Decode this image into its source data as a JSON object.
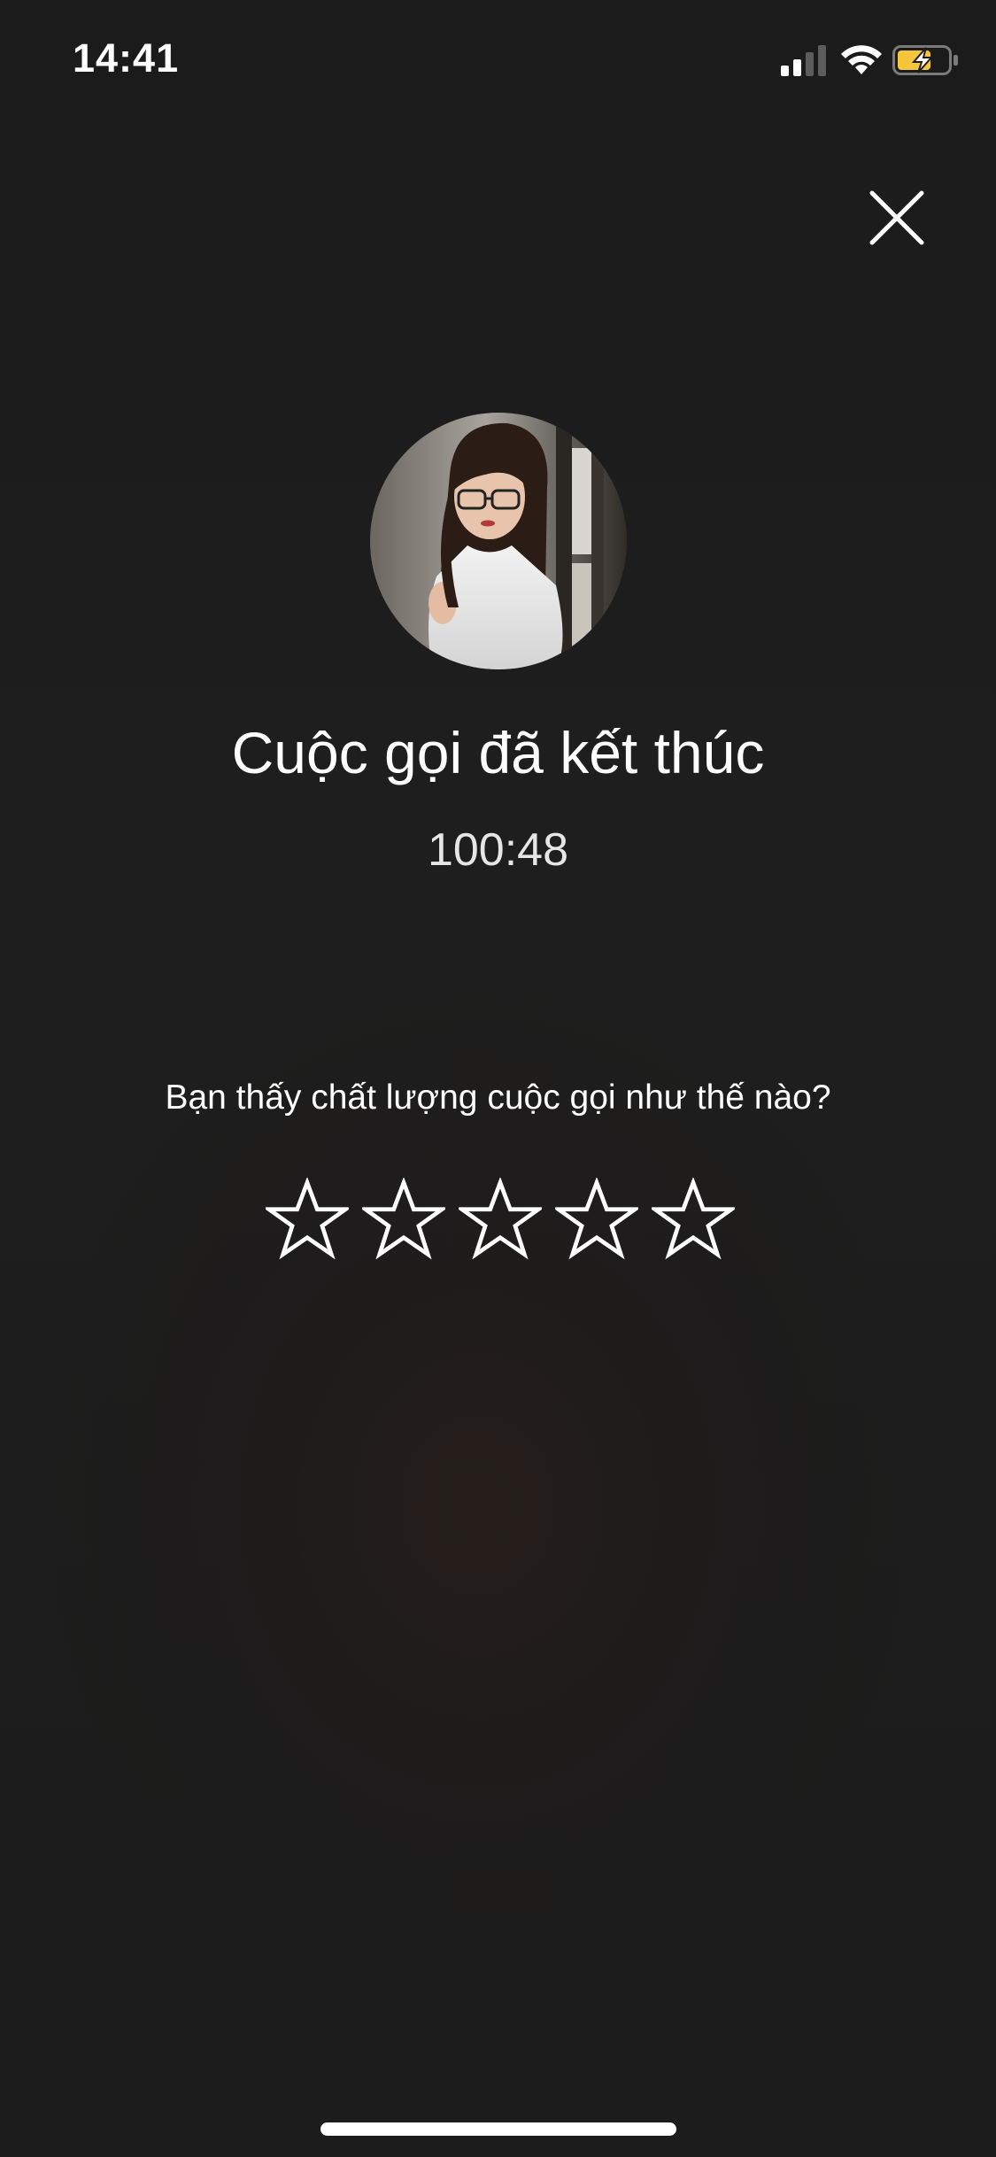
{
  "status_bar": {
    "time": "14:41",
    "signal_icon": "cellular-signal-icon",
    "wifi_icon": "wifi-icon",
    "battery_icon": "battery-charging-icon",
    "battery_color": "#f5c53b"
  },
  "close": {
    "icon": "close-icon"
  },
  "call": {
    "avatar": "caller-avatar",
    "title": "Cuộc gọi đã kết thúc",
    "duration": "100:48"
  },
  "rating": {
    "question": "Bạn thấy chất lượng cuộc gọi như thế nào?",
    "max_stars": 5,
    "selected_stars": 0,
    "star_icon": "star-outline-icon"
  },
  "colors": {
    "background": "#1c1c1c",
    "text": "#ffffff"
  }
}
